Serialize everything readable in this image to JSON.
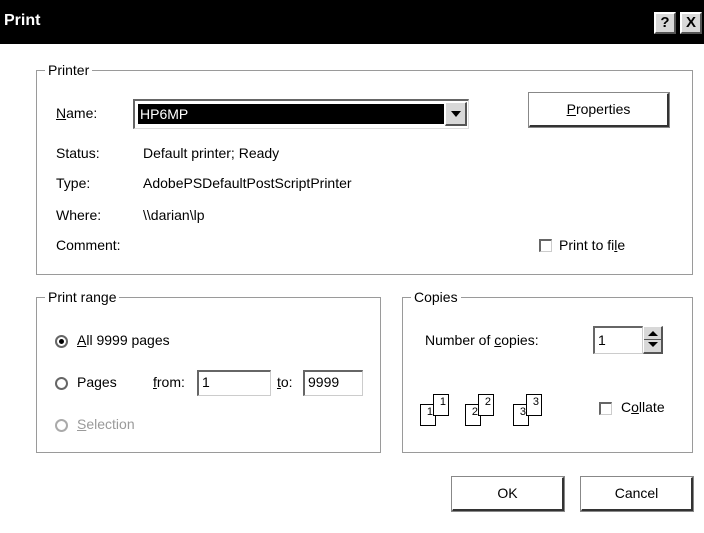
{
  "window": {
    "title": "Print",
    "help_label": "?",
    "close_label": "X"
  },
  "printer": {
    "group_label": "Printer",
    "name_label_prefix": "",
    "name_label_access": "N",
    "name_label_rest": "ame:",
    "name_value": "HP6MP",
    "properties_access": "P",
    "properties_rest": "roperties",
    "status_label": "Status:",
    "status_value": "Default printer; Ready",
    "type_label": "Type:",
    "type_value": "AdobePSDefaultPostScriptPrinter",
    "where_label": "Where:",
    "where_value": "\\\\darian\\lp",
    "comment_label": "Comment:",
    "print_to_file_pre": "Print to fi",
    "print_to_file_access": "l",
    "print_to_file_post": "e",
    "print_to_file_checked": false
  },
  "print_range": {
    "group_label": "Print range",
    "all_access": "A",
    "all_rest": "ll 9999 pages",
    "all_selected": true,
    "pages_pre": "Pa",
    "pages_access": "g",
    "pages_post": "es",
    "from_access": "f",
    "from_rest": "rom:",
    "from_value": "1",
    "to_access": "t",
    "to_rest": "o:",
    "to_value": "9999",
    "selection_access": "S",
    "selection_rest": "election"
  },
  "copies": {
    "group_label": "Copies",
    "number_pre": "Number of ",
    "number_access": "c",
    "number_post": "opies:",
    "number_value": "1",
    "collate_pre": "C",
    "collate_access": "o",
    "collate_post": "llate",
    "collate_checked": false,
    "page_icons": [
      "1",
      "1",
      "2",
      "2",
      "3",
      "3"
    ]
  },
  "buttons": {
    "ok": "OK",
    "cancel": "Cancel"
  }
}
